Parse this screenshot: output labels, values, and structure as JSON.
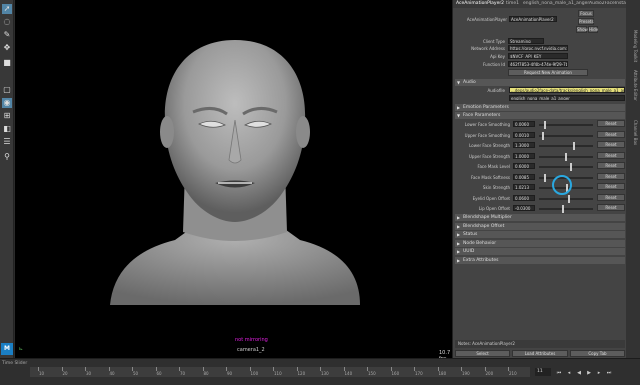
{
  "toolbar": {
    "tools": [
      "select-arrow",
      "lasso",
      "paint",
      "move",
      "rotate",
      "scale",
      "layout-single",
      "layout-four",
      "layout-side",
      "layout-list",
      "outliner",
      "search"
    ]
  },
  "viewport": {
    "hud_status": "not mirroring",
    "camera": "camera1_2",
    "fps": "10.7 fps"
  },
  "panel": {
    "tabs": [
      "AceAnimationPlayer2",
      "time1",
      "english_nona_male_a1_anger",
      "Audio2FaceInstance3"
    ],
    "node_label": "AceAnimationPlayer",
    "node_value": "AceAnimationPlayer2",
    "focus_btn": "Focus",
    "presets_btn": "Presets",
    "show_btn": "Show",
    "hide_btn": "Hide",
    "client_type_label": "Client Type",
    "client_type_value": "Streaming",
    "network_label": "Network Address",
    "network_value": "https://grpc.nvcf.nvidia.com:443",
    "apikey_label": "Api Key",
    "apikey_value": "$NVCF_API_KEY",
    "function_label": "Function Id",
    "function_value": "462f7853-4f4b-474e-9f29-7b0b9e05671c",
    "request_btn": "Request New Animation",
    "audio_section": "Audio",
    "audiofile_label": "Audiofile",
    "audiofile_value": "...deps/audio2face-data/tracks/english_nona_male_a1_anger.wav",
    "audiofile_sub": "english_nona_male_a1_anger",
    "emotion_section": "Emotion Parameters",
    "face_section": "Face Parameters",
    "params": [
      {
        "label": "Lower Face Smoothing",
        "value": "0.0060",
        "frac": 0.1
      },
      {
        "label": "Upper Face Smoothing",
        "value": "0.0010",
        "frac": 0.05
      },
      {
        "label": "Lower Face Strength",
        "value": "1.3000",
        "frac": 0.65
      },
      {
        "label": "Upper Face Strength",
        "value": "1.0000",
        "frac": 0.5
      },
      {
        "label": "Face Mask Level",
        "value": "0.6000",
        "frac": 0.6
      },
      {
        "label": "Face Mask Softness",
        "value": "0.0085",
        "frac": 0.1
      },
      {
        "label": "Skin Strength",
        "value": "1.0213",
        "frac": 0.51
      },
      {
        "label": "Eyelid Open Offset",
        "value": "0.0600",
        "frac": 0.55
      },
      {
        "label": "Lip Open Offset",
        "value": "-0.0300",
        "frac": 0.45
      }
    ],
    "reset_label": "Reset",
    "collapsed_sections": [
      "Blendshape Multiplier",
      "Blendshape Offset",
      "Status",
      "Node Behavior",
      "UUID",
      "Extra Attributes"
    ],
    "notes_label": "Notes:  AceAnimationPlayer2",
    "select_btn": "Select",
    "load_btn": "Load Attributes",
    "copy_btn": "Copy Tab"
  },
  "sidetabs": [
    "Attribute Editor",
    "Modeling Toolkit",
    "Channel Box"
  ],
  "timeline": {
    "label": "Time Slider",
    "ticks": [
      "10",
      "20",
      "30",
      "40",
      "50",
      "60",
      "70",
      "80",
      "90",
      "100",
      "110",
      "120",
      "130",
      "140",
      "150",
      "160",
      "170",
      "180",
      "190",
      "200",
      "210"
    ],
    "current_frame": "11",
    "logo": "M"
  },
  "colors": {
    "selected_tool": "#5285a6",
    "cursor_ring": "#2aa8e0",
    "audiofile_field": "#e6e07a",
    "hud_status": "#e020e0"
  }
}
